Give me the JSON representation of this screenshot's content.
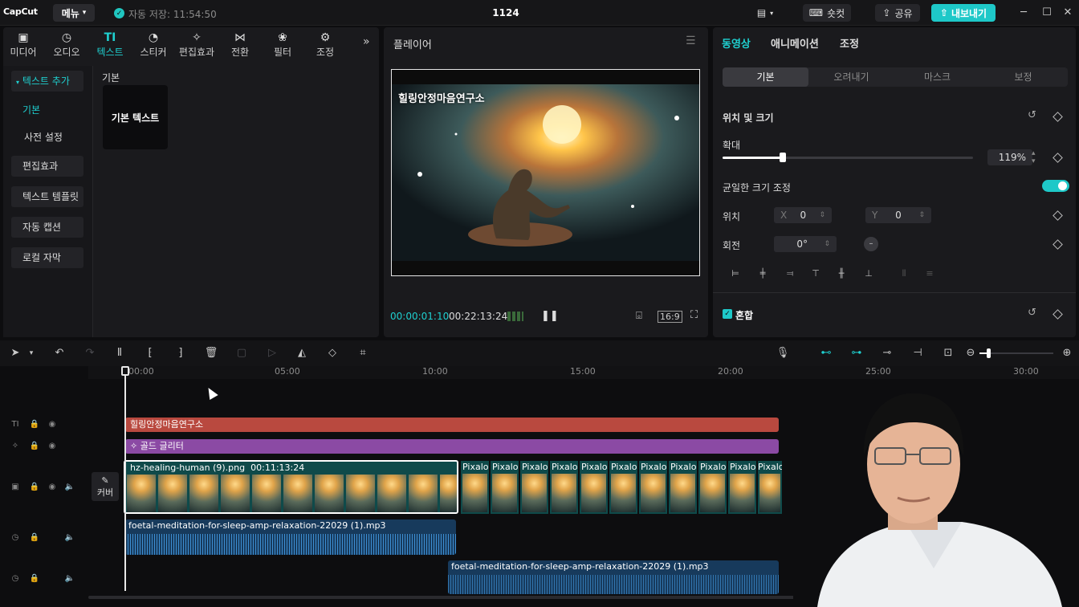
{
  "app": {
    "logo": "CapCut",
    "menu_label": "메뉴",
    "autosave_text": "자동 저장: 11:54:50",
    "project_title": "1124",
    "shortcut_label": "숏컷",
    "share_label": "공유",
    "export_label": "내보내기",
    "accent_color": "#1ec8c8"
  },
  "left_panel": {
    "tool_tabs": [
      {
        "icon": "media-icon",
        "label": "미디어"
      },
      {
        "icon": "audio-icon",
        "label": "오디오"
      },
      {
        "icon": "text-icon",
        "label": "텍스트"
      },
      {
        "icon": "sticker-icon",
        "label": "스티커"
      },
      {
        "icon": "effects-icon",
        "label": "편집효과"
      },
      {
        "icon": "transition-icon",
        "label": "전환"
      },
      {
        "icon": "filter-icon",
        "label": "필터"
      },
      {
        "icon": "adjust-icon",
        "label": "조정"
      }
    ],
    "sidebar": {
      "add_text": "텍스트 추가",
      "items": [
        "기본",
        "사전 설정",
        "편집효과",
        "텍스트 템플릿",
        "자동 캡션",
        "로컬 자막"
      ]
    },
    "section_title": "기본",
    "card_label": "기본 텍스트"
  },
  "player": {
    "title": "플레이어",
    "overlay_text": "힐링안정마음연구소",
    "current_time": "00:00:01:10",
    "total_time": "00:22:13:24",
    "ratio": "16:9"
  },
  "properties": {
    "tabs": [
      "동영상",
      "애니메이션",
      "조정"
    ],
    "subtabs": [
      "기본",
      "오려내기",
      "마스크",
      "보정"
    ],
    "section_title": "위치 및 크기",
    "scale_label": "확대",
    "scale_value": "119%",
    "scale_fraction": 0.24,
    "uniform_label": "균일한 크기 조정",
    "uniform_on": true,
    "position_label": "위치",
    "x_label": "X",
    "x_value": "0",
    "y_label": "Y",
    "y_value": "0",
    "rotation_label": "회전",
    "rotation_value": "0°",
    "blend_label": "혼합"
  },
  "timeline": {
    "ruler_ticks": [
      "00:00",
      "05:00",
      "10:00",
      "15:00",
      "20:00",
      "25:00",
      "30:00"
    ],
    "cover_label": "커버",
    "text_clip": "힐링안정마음연구소",
    "effect_clip": "골드 글리터",
    "main_clip_name": "hz-healing-human (9).png",
    "main_clip_duration": "00:11:13:24",
    "pixalo_label": "Pixalo",
    "audio_clip_1": "foetal-meditation-for-sleep-amp-relaxation-22029 (1).mp3",
    "audio_clip_2": "foetal-meditation-for-sleep-amp-relaxation-22029 (1).mp3"
  }
}
